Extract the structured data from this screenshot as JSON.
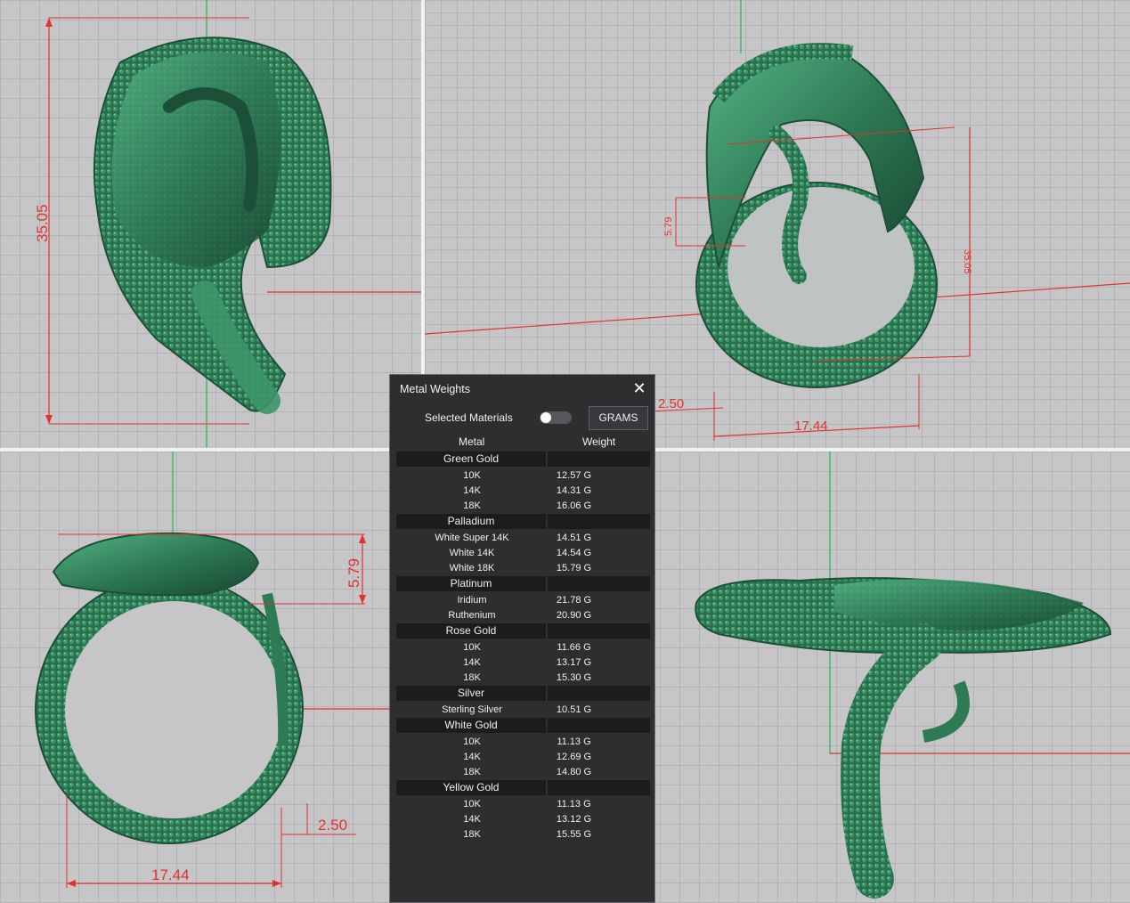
{
  "dimensions": {
    "top_left_height": "35.05",
    "top_right_height": "35.05",
    "top_right_top": "5.79",
    "top_right_band": "2.50",
    "top_right_width": "17.44",
    "bottom_left_top": "5.79",
    "bottom_left_band": "2.50",
    "bottom_left_width": "17.44"
  },
  "colors": {
    "ring_green": "#2e7a55",
    "ring_dark": "#1c4f37",
    "dim_red": "#e0322f",
    "panel_bg": "#2e2e31"
  },
  "panel": {
    "title": "Metal Weights",
    "close_icon": "✕",
    "selected_materials_label": "Selected Materials",
    "units_button": "GRAMS",
    "col_metal": "Metal",
    "col_weight": "Weight",
    "groups": [
      {
        "name": "Green Gold",
        "items": [
          {
            "label": "10K",
            "weight": "12.57 G"
          },
          {
            "label": "14K",
            "weight": "14.31 G"
          },
          {
            "label": "18K",
            "weight": "16.06 G"
          }
        ]
      },
      {
        "name": "Palladium",
        "items": [
          {
            "label": "White Super 14K",
            "weight": "14.51 G"
          },
          {
            "label": "White 14K",
            "weight": "14.54 G"
          },
          {
            "label": "White 18K",
            "weight": "15.79 G"
          }
        ]
      },
      {
        "name": "Platinum",
        "items": [
          {
            "label": "Iridium",
            "weight": "21.78 G"
          },
          {
            "label": "Ruthenium",
            "weight": "20.90 G"
          }
        ]
      },
      {
        "name": "Rose Gold",
        "items": [
          {
            "label": "10K",
            "weight": "11.66 G"
          },
          {
            "label": "14K",
            "weight": "13.17 G"
          },
          {
            "label": "18K",
            "weight": "15.30 G"
          }
        ]
      },
      {
        "name": "Silver",
        "items": [
          {
            "label": "Sterling Silver",
            "weight": "10.51 G"
          }
        ]
      },
      {
        "name": "White Gold",
        "items": [
          {
            "label": "10K",
            "weight": "11.13 G"
          },
          {
            "label": "14K",
            "weight": "12.69 G"
          },
          {
            "label": "18K",
            "weight": "14.80 G"
          }
        ]
      },
      {
        "name": "Yellow Gold",
        "items": [
          {
            "label": "10K",
            "weight": "11.13 G"
          },
          {
            "label": "14K",
            "weight": "13.12 G"
          },
          {
            "label": "18K",
            "weight": "15.55 G"
          }
        ]
      }
    ]
  }
}
